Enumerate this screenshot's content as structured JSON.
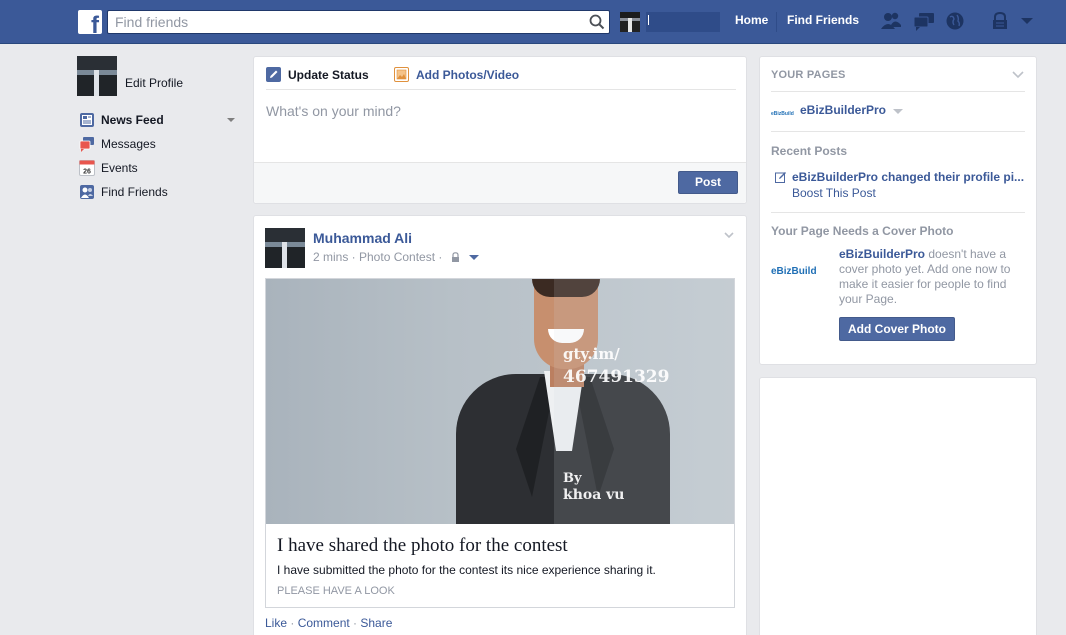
{
  "topbar": {
    "search_placeholder": "Find friends",
    "home": "Home",
    "find_friends": "Find Friends"
  },
  "left_nav": {
    "edit_profile": "Edit Profile",
    "items": [
      {
        "label": "News Feed",
        "icon": "news-feed-icon"
      },
      {
        "label": "Messages",
        "icon": "messages-icon"
      },
      {
        "label": "Events",
        "icon": "events-icon",
        "badge": "26"
      },
      {
        "label": "Find Friends",
        "icon": "find-friends-icon"
      }
    ]
  },
  "composer": {
    "tab_status": "Update Status",
    "tab_photo": "Add Photos/Video",
    "placeholder": "What's on your mind?",
    "post_button": "Post"
  },
  "post": {
    "author": "Muhammad Ali",
    "meta": "2 mins · Photo Contest ·",
    "image_watermark": [
      "gty.im/",
      "467491329",
      "By",
      "khoa vu"
    ],
    "share_title": "I have shared the photo for the contest",
    "share_desc": "I have submitted the photo for the contest its nice experience sharing it.",
    "share_source": "PLEASE HAVE A LOOK",
    "actions": {
      "like": "Like",
      "comment": "Comment",
      "share": "Share",
      "sep": " · "
    }
  },
  "right": {
    "your_pages": "YOUR PAGES",
    "page_name": "eBizBuilderPro",
    "recent_posts": "Recent Posts",
    "recent_post_text": "eBizBuilderPro changed their profile pi...",
    "boost": "Boost This Post",
    "cover_heading": "Your Page Needs a Cover Photo",
    "cover_page_name": "eBizBuilderPro",
    "cover_text": " doesn't have a cover photo yet. Add one now to make it easier for people to find your Page.",
    "cover_button": "Add Cover Photo",
    "logo_small": "eBizBuild",
    "logo_text": "eBizBuild"
  },
  "colors": {
    "brand": "#3b5998",
    "link": "#3b5998",
    "background": "#e9eaed"
  }
}
